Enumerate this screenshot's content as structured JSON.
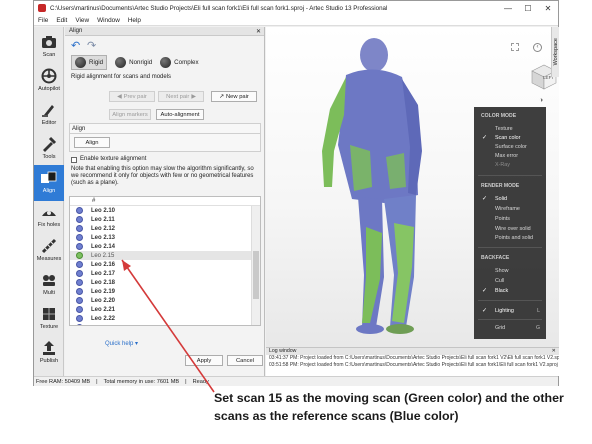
{
  "window": {
    "title": "C:\\Users\\martinus\\Documents\\Artec Studio Projects\\Eli full scan fork1\\Eli full scan fork1.sproj - Artec Studio 13 Professional",
    "minimize": "—",
    "maximize": "☐",
    "close": "✕"
  },
  "menu": [
    "File",
    "Edit",
    "View",
    "Window",
    "Help"
  ],
  "toolbar": [
    {
      "label": "Scan",
      "icon": "camera-icon"
    },
    {
      "label": "Autopilot",
      "icon": "autopilot-icon"
    },
    {
      "label": "Editor",
      "icon": "editor-icon"
    },
    {
      "label": "Tools",
      "icon": "tools-icon"
    },
    {
      "label": "Align",
      "icon": "align-icon"
    },
    {
      "label": "Fix holes",
      "icon": "fix-holes-icon"
    },
    {
      "label": "Measures",
      "icon": "measures-icon"
    },
    {
      "label": "Multi",
      "icon": "multi-icon"
    },
    {
      "label": "Texture",
      "icon": "texture-icon"
    },
    {
      "label": "Publish",
      "icon": "publish-icon"
    }
  ],
  "panel": {
    "title": "Align",
    "modes": [
      "Rigid",
      "Nonrigid",
      "Complex"
    ],
    "mode_desc": "Rigid alignment for scans and models",
    "prev_pair": "Prev pair",
    "next_pair": "Next pair",
    "new_pair": "New pair",
    "align_markers": "Align markers",
    "auto_alignment": "Auto-alignment",
    "align_section": "Align",
    "align_button": "Align",
    "texture_checkbox": "Enable texture alignment",
    "note": "Note that enabling this option may slow the algorithm significantly, so we recommend it only for objects with few or no geometrical features (such as a plane).",
    "list_header": "#",
    "scans": [
      "Leo 2.10",
      "Leo 2.11",
      "Leo 2.12",
      "Leo 2.13",
      "Leo 2.14",
      "Leo 2.15",
      "Leo 2.16",
      "Leo 2.17",
      "Leo 2.18",
      "Leo 2.19",
      "Leo 2.20",
      "Leo 2.21",
      "Leo 2.22",
      "Leo 2.23"
    ],
    "quick_help": "Quick help",
    "apply": "Apply",
    "cancel": "Cancel"
  },
  "viewport": {
    "workspace_tab": "Workspace",
    "cube_label": "LEFT",
    "menu": {
      "color_mode": "COLOR MODE",
      "texture": "Texture",
      "scan_color": "Scan color",
      "surface_color": "Surface color",
      "max_error": "Max error",
      "xray": "X-Ray",
      "render_mode": "RENDER MODE",
      "solid": "Solid",
      "wireframe": "Wireframe",
      "points": "Points",
      "wire_over_solid": "Wire over solid",
      "points_and_solid": "Points and solid",
      "backface": "BACKFACE",
      "show": "Show",
      "cull": "Cull",
      "black": "Black",
      "lighting": "Lighting",
      "lighting_key": "L",
      "grid": "Grid",
      "grid_key": "G"
    }
  },
  "log": {
    "title": "Log window",
    "lines": [
      "03:41:37 PM: Project loaded from C:\\Users\\martinus\\Documents\\Artec Studio Projects\\Eli full scan fork1 V2\\Eli full scan fork1 V2.sproj",
      "03:51:58 PM: Project loaded from C:\\Users\\martinus\\Documents\\Artec Studio Projects\\Eli full scan fork1\\Eli full scan fork1 V2.sproj"
    ]
  },
  "status": {
    "free_ram": "Free RAM: 50409 MB",
    "total_memory": "Total memory in use: 7601 MB",
    "ready": "Ready"
  },
  "caption": "Set scan 15 as the moving scan (Green color) and the other scans as the reference scans (Blue color)",
  "colors": {
    "moving_scan": "#7cc060",
    "reference_scan": "#6f7fd0",
    "arrow": "#d43a3a",
    "active_tool": "#2f7bd6"
  }
}
